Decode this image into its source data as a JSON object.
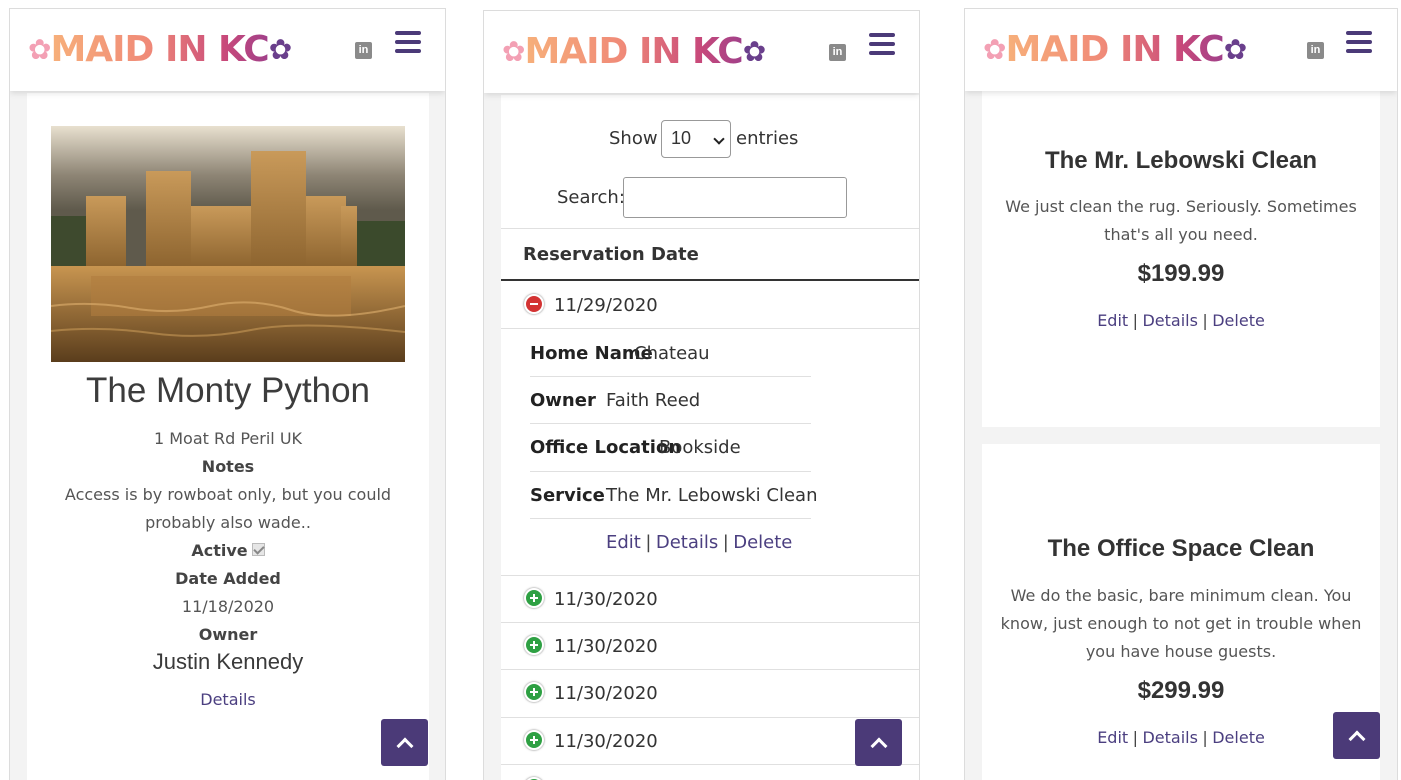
{
  "brand": {
    "logo_text": "MAID IN KC"
  },
  "home_detail": {
    "title": "The Monty Python",
    "address": "1 Moat Rd Peril UK",
    "notes_label": "Notes",
    "notes_line1": "Access is by rowboat only, but you could",
    "notes_line2": "probably also wade..",
    "active_label": "Active",
    "active_checked": true,
    "date_added_label": "Date Added",
    "date_added": "11/18/2020",
    "owner_label": "Owner",
    "owner_name": "Justin Kennedy",
    "details_link": "Details"
  },
  "reservations": {
    "show_label": "Show",
    "entries_select": "10",
    "entries_label": "entries",
    "search_label": "Search:",
    "search_value": "",
    "column_header": "Reservation Date",
    "expanded": {
      "date": "11/29/2020",
      "home_name_label": "Home Name",
      "home_name": "Chateau",
      "owner_label": "Owner",
      "owner": "Faith Reed",
      "office_label": "Office Location",
      "office": "Bookside",
      "service_label": "Service",
      "service": "The Mr. Lebowski Clean",
      "edit": "Edit",
      "details": "Details",
      "delete": "Delete",
      "sep": "|"
    },
    "rows": [
      "11/30/2020",
      "11/30/2020",
      "11/30/2020",
      "11/30/2020"
    ]
  },
  "services": [
    {
      "title": "The Mr. Lebowski Clean",
      "desc_line1": "We just clean the rug. Seriously. Sometimes",
      "desc_line2": "that's all you need.",
      "price": "$199.99",
      "edit": "Edit",
      "details": "Details",
      "delete": "Delete",
      "sep": "|"
    },
    {
      "title": "The Office Space Clean",
      "desc_line1": "We do the basic, bare minimum clean. You",
      "desc_line2": "know, just enough to not get in trouble when",
      "desc_line3": "you have house guests.",
      "price": "$299.99",
      "edit": "Edit",
      "details": "Details",
      "delete": "Delete",
      "sep": "|"
    }
  ],
  "icons": {
    "linkedin": "linkedin-icon",
    "menu": "hamburger-menu-icon",
    "scroll_top": "chevron-up-icon"
  },
  "colors": {
    "accent_purple": "#4b3a78",
    "expand_green": "#2ea043",
    "collapse_red": "#d33333"
  }
}
